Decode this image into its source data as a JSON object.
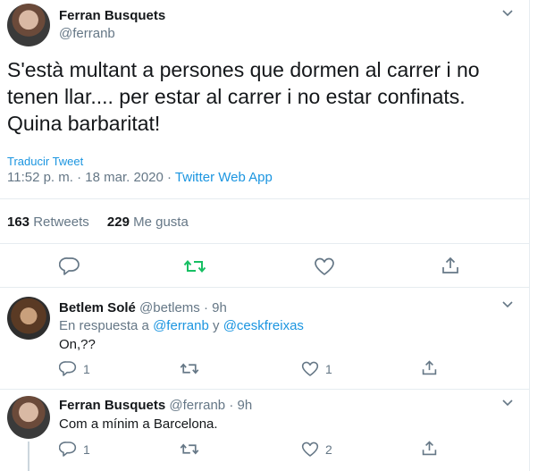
{
  "main_tweet": {
    "name": "Ferran Busquets",
    "handle": "@ferranb",
    "text_line1": "S'està multant a persones que dormen al carrer i no",
    "text_line2": "tenen llar.... per estar al carrer i no estar confinats.",
    "text_line3": "Quina barbaritat!",
    "translate": "Traducir Tweet",
    "time": "11:52 p. m.",
    "sep": "·",
    "date": "18 mar. 2020",
    "source": "Twitter Web App",
    "retweets_count": "163",
    "retweets_label": "Retweets",
    "likes_count": "229",
    "likes_label": "Me gusta"
  },
  "replies": [
    {
      "name": "Betlem Solé",
      "handle": "@betlems",
      "dot": "·",
      "age": "9h",
      "reply_prefix": "En respuesta a",
      "reply_user1": "@ferranb",
      "reply_and": "y",
      "reply_user2": "@ceskfreixas",
      "text": "On,??",
      "reply_count": "1",
      "like_count": "1"
    },
    {
      "name": "Ferran Busquets",
      "handle": "@ferranb",
      "dot": "·",
      "age": "9h",
      "text": "Com a mínim a Barcelona.",
      "reply_count": "1",
      "like_count": "2"
    }
  ],
  "colors": {
    "text": "#14171a",
    "muted": "#657786",
    "link": "#1b95e0",
    "retweet_green": "#17bf63",
    "divider": "#e6ecf0"
  }
}
